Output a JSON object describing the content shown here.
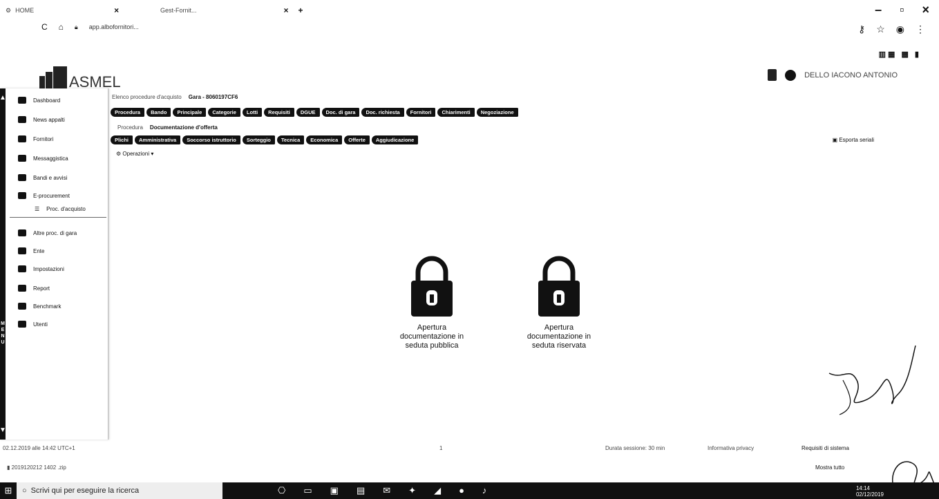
{
  "browser": {
    "tabs": [
      {
        "title": "HOME"
      },
      {
        "title": "Gest-Fornit..."
      }
    ],
    "new_tab": "+",
    "url": "app.albofornitori..."
  },
  "header": {
    "logo_text": "ASMEL",
    "user_name": "DELLO IACONO ANTONIO"
  },
  "sidebar": {
    "items": [
      {
        "label": "Dashboard",
        "icon": "home-icon"
      },
      {
        "label": "News appalti",
        "icon": "news-icon"
      },
      {
        "label": "Fornitori",
        "icon": "truck-icon"
      },
      {
        "label": "Messaggistica",
        "icon": "at-icon"
      },
      {
        "label": "Bandi e avvisi",
        "icon": "megaphone-icon"
      },
      {
        "label": "E-procurement",
        "icon": "procurement-icon"
      },
      {
        "label": "Proc. d'acquisto",
        "icon": "list-icon"
      },
      {
        "label": "Altre proc. di gara",
        "icon": "building-icon"
      },
      {
        "label": "Ente",
        "icon": "users-icon"
      },
      {
        "label": "Impostazioni",
        "icon": "gear-icon"
      },
      {
        "label": "Report",
        "icon": "report-icon"
      },
      {
        "label": "Benchmark",
        "icon": "benchmark-icon"
      },
      {
        "label": "Utenti",
        "icon": "user-icon"
      }
    ],
    "rail_label": "MENU"
  },
  "breadcrumb": {
    "prefix": "Elenco procedure d'acquisto",
    "current": "Gara - 8060197CF6"
  },
  "pills_row1": [
    "Procedura",
    "Bando",
    "Principale",
    "Categorie",
    "Lotti",
    "Requisiti",
    "DGUE",
    "Doc. di gara",
    "Doc. richiesta",
    "Fornitori",
    "Chiarimenti",
    "Negoziazione"
  ],
  "breadcrumb2": {
    "prefix": "Procedura",
    "current": "Documentazione d'offerta"
  },
  "pills_row2": [
    "Plichi",
    "Amministrativa",
    "Soccorso istruttorio",
    "Sorteggio",
    "Tecnica",
    "Economica",
    "Offerte",
    "Aggiudicazione"
  ],
  "export_label": "Esporta seriali",
  "ops_label": "Operazioni",
  "locks": [
    {
      "label_lines": [
        "Apertura",
        "documentazione in",
        "seduta pubblica"
      ]
    },
    {
      "label_lines": [
        "Apertura",
        "documentazione in",
        "seduta riservata"
      ]
    }
  ],
  "footer": {
    "timestamp": "02.12.2019 alle 14:42 UTC+1",
    "page": "1",
    "session": "Durata sessione: 30 min",
    "privacy": "Informativa privacy",
    "requirements": "Requisiti di sistema",
    "download_file": "2019120212 1402 .zip",
    "show_all": "Mostra tutto"
  },
  "taskbar": {
    "search_placeholder": "Scrivi qui per eseguire la ricerca",
    "time": "14:14",
    "date": "02/12/2019"
  }
}
